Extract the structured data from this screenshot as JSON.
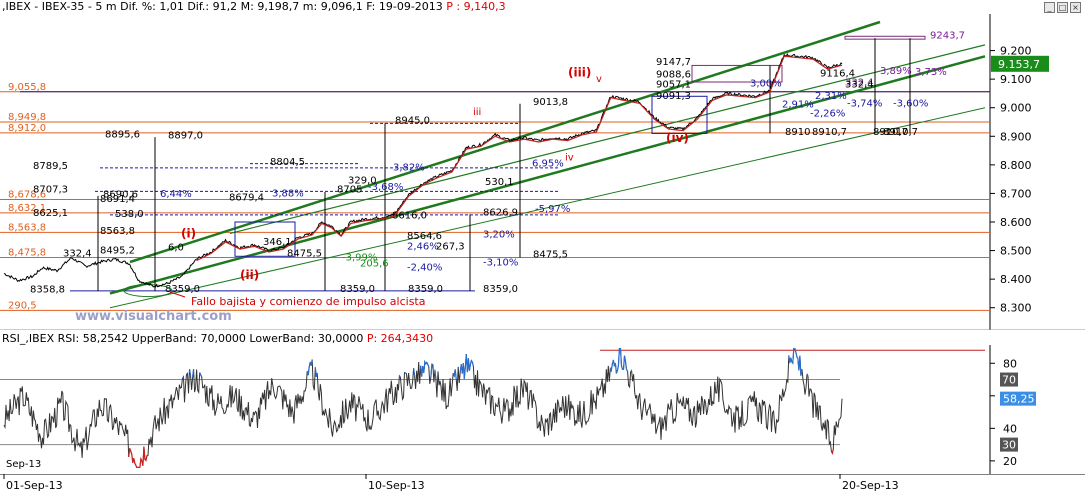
{
  "header": {
    "price_line_prefix": ",IBEX - IBEX-35 -  5 m Dif. %: 1,01 Dif.: 91,2 M: 9,198,7 m: 9,096,1 F: 19-09-2013 ",
    "price_line_value": "P : 9,140,3",
    "rsi_line_prefix": "RSI_,IBEX RSI: 58,2542 UpperBand: 70,0000 LowerBand: 30,0000 ",
    "rsi_line_value": "P: 264,3430",
    "win_buttons": [
      "_",
      "□",
      "×"
    ]
  },
  "colors": {
    "price_line": "#000000",
    "channel": "#1f7a1f",
    "fib_level": "#e06020",
    "support_line": "#1a1aa0",
    "wave_label": "#d40000",
    "rsi_line": "#333333",
    "rsi_overbought": "#2a6dd0",
    "rsi_oversold": "#d02020",
    "last_price_bg": "#1a8c1a",
    "last_rsi_bg": "#3b8ee6"
  },
  "chart_data": [
    {
      "type": "line",
      "name_in_header": "IBEX-35 5 m",
      "ylim": [
        8250,
        9300
      ],
      "yticks": [
        "9.200",
        "9.100",
        "9.000",
        "8.900",
        "8.800",
        "8.700",
        "8.600",
        "8.500",
        "8.400",
        "8.300"
      ],
      "last_value_label": "9.153,7",
      "x_dates": [
        "01-Sep-13",
        "10-Sep-13",
        "20-Sep-13"
      ],
      "price_keypoints": [
        [
          0,
          8420
        ],
        [
          3,
          8395
        ],
        [
          6,
          8410
        ],
        [
          8,
          8440
        ],
        [
          11,
          8430
        ],
        [
          14,
          8475
        ],
        [
          17,
          8445
        ],
        [
          20,
          8460
        ],
        [
          23,
          8470
        ],
        [
          26,
          8455
        ],
        [
          28,
          8395
        ],
        [
          31,
          8375
        ],
        [
          34,
          8385
        ],
        [
          37,
          8410
        ],
        [
          40,
          8470
        ],
        [
          43,
          8495
        ],
        [
          46,
          8535
        ],
        [
          49,
          8510
        ],
        [
          52,
          8520
        ],
        [
          55,
          8500
        ],
        [
          58,
          8510
        ],
        [
          61,
          8545
        ],
        [
          64,
          8560
        ],
        [
          66,
          8600
        ],
        [
          68,
          8585
        ],
        [
          70,
          8555
        ],
        [
          72,
          8600
        ],
        [
          75,
          8610
        ],
        [
          78,
          8615
        ],
        [
          81,
          8625
        ],
        [
          84,
          8695
        ],
        [
          87,
          8735
        ],
        [
          90,
          8760
        ],
        [
          93,
          8780
        ],
        [
          96,
          8860
        ],
        [
          99,
          8870
        ],
        [
          102,
          8905
        ],
        [
          105,
          8885
        ],
        [
          108,
          8895
        ],
        [
          111,
          8885
        ],
        [
          114,
          8895
        ],
        [
          117,
          8890
        ],
        [
          120,
          8910
        ],
        [
          123,
          8920
        ],
        [
          126,
          9040
        ],
        [
          129,
          9030
        ],
        [
          132,
          9020
        ],
        [
          135,
          8965
        ],
        [
          138,
          8930
        ],
        [
          141,
          8925
        ],
        [
          144,
          8965
        ],
        [
          147,
          9030
        ],
        [
          150,
          9050
        ],
        [
          153,
          9045
        ],
        [
          156,
          9040
        ],
        [
          159,
          9060
        ],
        [
          162,
          9185
        ],
        [
          165,
          9180
        ],
        [
          168,
          9175
        ],
        [
          171,
          9140
        ],
        [
          174,
          9153.7
        ]
      ],
      "fib_levels": [
        {
          "value": 9055.8,
          "label": "9,055,8"
        },
        {
          "value": 8949.8,
          "label": "8,949,8"
        },
        {
          "value": 8912.0,
          "label": "8,912,0"
        },
        {
          "value": 8678.6,
          "label": "8,678,6"
        },
        {
          "value": 8632.1,
          "label": "8,632,1"
        },
        {
          "value": 8563.8,
          "label": "8,563,8"
        },
        {
          "value": 8475.8,
          "label": "8,475,8"
        },
        {
          "value": 8290.5,
          "label": "290,5"
        }
      ],
      "wave_labels": [
        "(i)",
        "(ii)",
        "(iii)",
        "(iv)"
      ],
      "small_wave_labels": [
        "iii",
        "iv",
        "v"
      ],
      "text_labels": [
        "Fallo bajista y comienzo de impulso alcista",
        "www.visualchart.com"
      ],
      "annotations": [
        "9147,7",
        "9088,6",
        "9057,1",
        "9091,3",
        "9013,8",
        "8945,0",
        "8895,6",
        "8897,0",
        "8789,5",
        "8707,3",
        "8690,6",
        "6,44%",
        "8625,1",
        "538,0",
        "8804,5",
        "8679,4",
        "3,82%",
        "329,0",
        "-3,68%",
        "3,88%",
        "8705",
        "8616,0",
        "8626,9",
        "-5,97%",
        "3,20%",
        "-3,10%",
        "2,46%",
        "267,3",
        "-2,40%",
        "8564,6",
        "8475,5",
        "8359,0",
        "8359,0",
        "8359,0",
        "8359,0",
        "346,1",
        "8475,5",
        "-3,99%",
        "205,6",
        "6,95%",
        "530,1",
        "9243,7",
        "3,89%",
        "3,73%",
        "332,4",
        "-3,74%",
        "-3,60%",
        "8910,7",
        "8910,7",
        "8910",
        "8910,7",
        "3,00%",
        "2,91%",
        "-2,26%",
        "9116,4",
        "2,31%",
        "332,4",
        "8691,4",
        "8563,8",
        "8495,2",
        "8358,8",
        "332,4",
        "6,0"
      ]
    },
    {
      "type": "line",
      "title": "RSI",
      "ylim": [
        15,
        90
      ],
      "yticks": [
        "80",
        "60",
        "40",
        "20"
      ],
      "band_labels": [
        "70",
        "30"
      ],
      "last_value_label": "58,25",
      "upper_band": 70,
      "lower_band": 30,
      "rsi_keypoints": [
        [
          0,
          45
        ],
        [
          4,
          60
        ],
        [
          8,
          35
        ],
        [
          12,
          55
        ],
        [
          16,
          25
        ],
        [
          20,
          55
        ],
        [
          24,
          40
        ],
        [
          28,
          20
        ],
        [
          32,
          45
        ],
        [
          36,
          60
        ],
        [
          40,
          72
        ],
        [
          44,
          55
        ],
        [
          48,
          60
        ],
        [
          52,
          45
        ],
        [
          56,
          68
        ],
        [
          60,
          50
        ],
        [
          64,
          75
        ],
        [
          68,
          40
        ],
        [
          72,
          55
        ],
        [
          76,
          45
        ],
        [
          80,
          60
        ],
        [
          84,
          70
        ],
        [
          88,
          75
        ],
        [
          92,
          60
        ],
        [
          96,
          78
        ],
        [
          100,
          60
        ],
        [
          104,
          50
        ],
        [
          108,
          65
        ],
        [
          112,
          40
        ],
        [
          116,
          55
        ],
        [
          120,
          48
        ],
        [
          124,
          62
        ],
        [
          128,
          88
        ],
        [
          132,
          55
        ],
        [
          136,
          40
        ],
        [
          140,
          55
        ],
        [
          144,
          48
        ],
        [
          148,
          65
        ],
        [
          152,
          45
        ],
        [
          156,
          55
        ],
        [
          160,
          42
        ],
        [
          164,
          88
        ],
        [
          168,
          55
        ],
        [
          172,
          30
        ],
        [
          174,
          58.25
        ]
      ]
    }
  ],
  "date_axis": {
    "labels": [
      "01-Sep-13",
      "10-Sep-13",
      "20-Sep-13"
    ],
    "rsi_pane_date": "Sep-13"
  }
}
